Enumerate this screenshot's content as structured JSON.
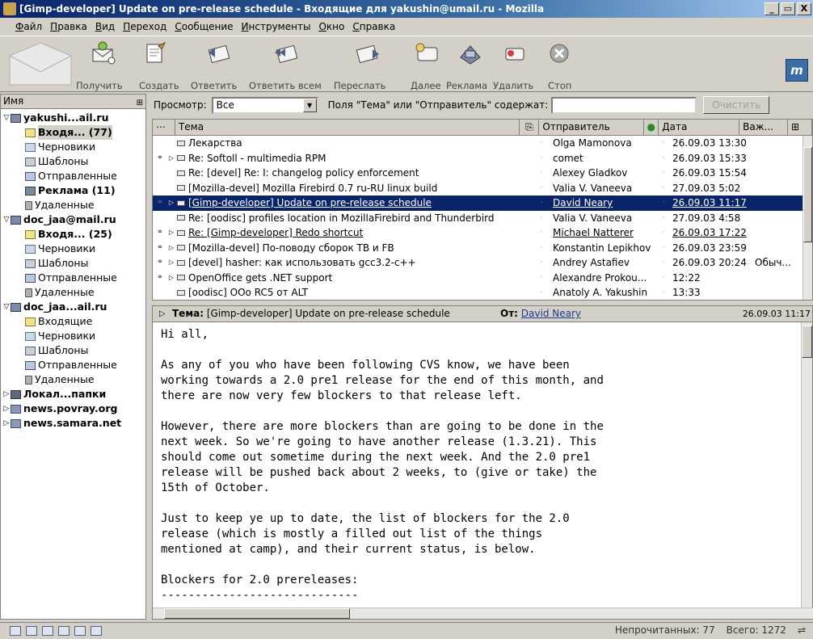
{
  "window": {
    "title": "[Gimp-developer] Update on pre-release schedule - Входящие для yakushin@umail.ru - Mozilla",
    "controls": [
      "_",
      "▭",
      "X"
    ]
  },
  "menu": [
    "Файл",
    "Правка",
    "Вид",
    "Переход",
    "Сообщение",
    "Инструменты",
    "Окно",
    "Справка"
  ],
  "toolbar": {
    "get": "Получить",
    "new": "Создать",
    "reply": "Ответить",
    "reply_all": "Ответить всем",
    "forward": "Переслать",
    "next": "Далее",
    "spam": "Реклама",
    "delete": "Удалить",
    "stop": "Стоп",
    "logo": "m"
  },
  "folders": {
    "header": "Имя",
    "items": [
      {
        "label": "yakushi...ail.ru",
        "type": "acc",
        "level": 0,
        "twisty": "▽",
        "bold": true
      },
      {
        "label": "Входя... (77)",
        "type": "inb",
        "level": 1,
        "twisty": "",
        "bold": true,
        "selected": true
      },
      {
        "label": "Черновики",
        "type": "drf",
        "level": 1,
        "twisty": "",
        "bold": false
      },
      {
        "label": "Шаблоны",
        "type": "tpl",
        "level": 1,
        "twisty": "",
        "bold": false
      },
      {
        "label": "Отправленные",
        "type": "snt",
        "level": 1,
        "twisty": "",
        "bold": false
      },
      {
        "label": "Реклама (11)",
        "type": "spam",
        "level": 1,
        "twisty": "",
        "bold": true
      },
      {
        "label": "Удаленные",
        "type": "del",
        "level": 1,
        "twisty": "",
        "bold": false
      },
      {
        "label": "doc_jaa@mail.ru",
        "type": "acc",
        "level": 0,
        "twisty": "▽",
        "bold": true
      },
      {
        "label": "Входя... (25)",
        "type": "inb",
        "level": 1,
        "twisty": "",
        "bold": true
      },
      {
        "label": "Черновики",
        "type": "drf",
        "level": 1,
        "twisty": "",
        "bold": false
      },
      {
        "label": "Шаблоны",
        "type": "tpl",
        "level": 1,
        "twisty": "",
        "bold": false
      },
      {
        "label": "Отправленные",
        "type": "snt",
        "level": 1,
        "twisty": "",
        "bold": false
      },
      {
        "label": "Удаленные",
        "type": "del",
        "level": 1,
        "twisty": "",
        "bold": false
      },
      {
        "label": "doc_jaa...ail.ru",
        "type": "acc",
        "level": 0,
        "twisty": "▽",
        "bold": true
      },
      {
        "label": "Входящие",
        "type": "inb",
        "level": 1,
        "twisty": "",
        "bold": false
      },
      {
        "label": "Черновики",
        "type": "drf",
        "level": 1,
        "twisty": "",
        "bold": false
      },
      {
        "label": "Шаблоны",
        "type": "tpl",
        "level": 1,
        "twisty": "",
        "bold": false
      },
      {
        "label": "Отправленные",
        "type": "snt",
        "level": 1,
        "twisty": "",
        "bold": false
      },
      {
        "label": "Удаленные",
        "type": "del",
        "level": 1,
        "twisty": "",
        "bold": false
      },
      {
        "label": "Локал...папки",
        "type": "loc",
        "level": 0,
        "twisty": "▷",
        "bold": true
      },
      {
        "label": "news.povray.org",
        "type": "news",
        "level": 0,
        "twisty": "▷",
        "bold": true
      },
      {
        "label": "news.samara.net",
        "type": "news",
        "level": 0,
        "twisty": "▷",
        "bold": true
      }
    ]
  },
  "filter": {
    "view_label": "Просмотр:",
    "view_value": "Все",
    "search_label": "Поля \"Тема\" или \"Отправитель\" содержат:",
    "search_value": "",
    "clear": "Очистить"
  },
  "columns": {
    "subject": "Тема",
    "from": "Отправитель",
    "date": "Дата",
    "priority": "Важ..."
  },
  "messages": [
    {
      "thread": false,
      "twisty": "",
      "subject": "Лекарства",
      "from": "Olga Mamonova",
      "date": "26.09.03 13:30",
      "priority": "",
      "selected": false,
      "under": false
    },
    {
      "thread": true,
      "twisty": "▷",
      "subject": "Re: Softoll - multimedia RPM",
      "from": "comet",
      "date": "26.09.03 15:33",
      "priority": "",
      "selected": false,
      "under": false
    },
    {
      "thread": false,
      "twisty": "",
      "subject": "Re: [devel] Re: I: changelog policy enforcement",
      "from": "Alexey Gladkov",
      "date": "26.09.03 15:54",
      "priority": "",
      "selected": false,
      "under": false
    },
    {
      "thread": false,
      "twisty": "",
      "subject": "[Mozilla-devel] Mozilla Firebird 0.7 ru-RU linux build",
      "from": "Valia V. Vaneeva",
      "date": "27.09.03 5:02",
      "priority": "",
      "selected": false,
      "under": false
    },
    {
      "thread": true,
      "twisty": "▷",
      "subject": "[Gimp-developer] Update on pre-release schedule",
      "from": "David Neary",
      "date": "26.09.03 11:17",
      "priority": "",
      "selected": true,
      "under": true
    },
    {
      "thread": false,
      "twisty": "",
      "subject": "Re: [oodisc] profiles location in MozillaFirebird and Thunderbird",
      "from": "Valia V. Vaneeva",
      "date": "27.09.03 4:58",
      "priority": "",
      "selected": false,
      "under": false
    },
    {
      "thread": true,
      "twisty": "▷",
      "subject": "Re: [Gimp-developer] Redo shortcut",
      "from": "Michael Natterer",
      "date": "26.09.03 17:22",
      "priority": "",
      "selected": false,
      "under": true
    },
    {
      "thread": true,
      "twisty": "▷",
      "subject": "[Mozilla-devel] По-поводу сборок TB и FB",
      "from": "Konstantin Lepikhov",
      "date": "26.09.03 23:59",
      "priority": "",
      "selected": false,
      "under": false
    },
    {
      "thread": true,
      "twisty": "▷",
      "subject": "[devel] hasher: как использовать gcc3.2-c++",
      "from": "Andrey Astafiev",
      "date": "26.09.03 20:24",
      "priority": "Обыч...",
      "selected": false,
      "under": false
    },
    {
      "thread": true,
      "twisty": "▷",
      "subject": "OpenOffice gets .NET support",
      "from": "Alexandre Prokou...",
      "date": "12:22",
      "priority": "",
      "selected": false,
      "under": false
    },
    {
      "thread": false,
      "twisty": "",
      "subject": "[oodisc] OOo RC5 от ALT",
      "from": "Anatoly A. Yakushin",
      "date": "13:33",
      "priority": "",
      "selected": false,
      "under": false
    }
  ],
  "message": {
    "subject_label": "Тема:",
    "subject": "[Gimp-developer] Update on pre-release schedule",
    "from_label": "От:",
    "from": "David Neary",
    "date": "26.09.03 11:17",
    "body": "Hi all,\n\nAs any of you who have been following CVS know, we have been\nworking towards a 2.0 pre1 release for the end of this month, and\nthere are now very few blockers to that release left.\n\nHowever, there are more blockers than are going to be done in the\nnext week. So we're going to have another release (1.3.21). This\nshould come out sometime during the next week. And the 2.0 pre1\nrelease will be pushed back about 2 weeks, to (give or take) the\n15th of October.\n\nJust to keep ye up to date, the list of blockers for the 2.0\nrelease (which is mostly a filled out list of the things\nmentioned at camp), and their current status, is below.\n\nBlockers for 2.0 prereleases:\n-----------------------------"
  },
  "status": {
    "unread": "Непрочитанных: 77",
    "total": "Всего: 1272"
  }
}
